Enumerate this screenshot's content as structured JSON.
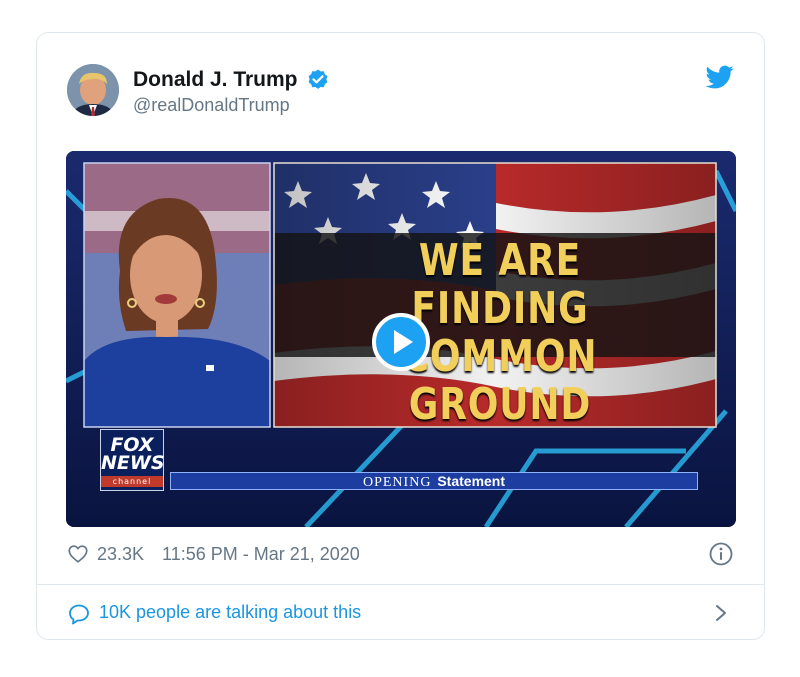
{
  "tweet": {
    "display_name": "Donald J. Trump",
    "handle": "@realDonaldTrump",
    "likes": "23.3K",
    "timestamp": "11:56 PM - Mar 21, 2020",
    "conversation": "10K people are talking about this"
  },
  "video": {
    "headline_line1": "WE ARE FINDING",
    "headline_line2": "COMMON GROUND",
    "banner_word1": "OPENING",
    "banner_word2": "Statement",
    "network_line1": "FOX",
    "network_line2": "NEWS",
    "network_line3": "channel"
  },
  "icons": {
    "verified": "verified-badge-icon",
    "brand": "twitter-bird-icon",
    "like": "heart-icon",
    "info": "info-icon",
    "reply": "speech-bubble-icon",
    "expand": "chevron-right-icon",
    "play": "play-icon"
  },
  "colors": {
    "accent": "#1da1f2",
    "link": "#1b95e0",
    "muted": "#657786",
    "headline_gold": "#f2cf5a"
  }
}
